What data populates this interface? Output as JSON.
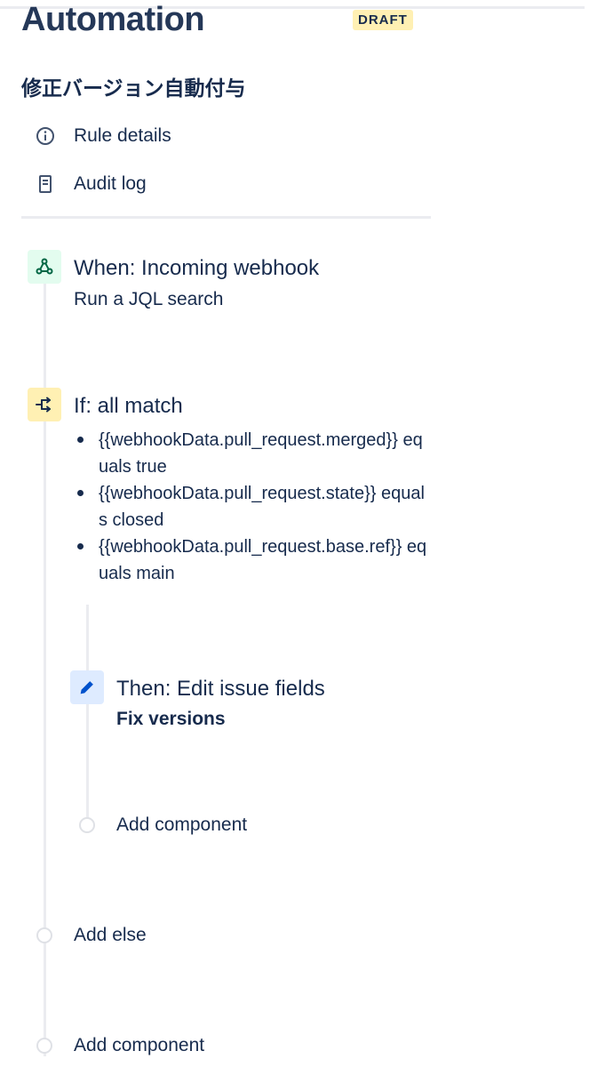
{
  "header": {
    "title": "Automation",
    "status_badge": "DRAFT"
  },
  "rule": {
    "name": "修正バージョン自動付与"
  },
  "nav": {
    "items": [
      {
        "label": "Rule details",
        "icon": "info-icon"
      },
      {
        "label": "Audit log",
        "icon": "document-icon"
      }
    ]
  },
  "components": {
    "trigger": {
      "title": "When: Incoming webhook",
      "subtitle": "Run a JQL search",
      "icon": "webhook-icon",
      "accent": "#e3fcef"
    },
    "condition": {
      "title": "If: all match",
      "icon": "branch-icon",
      "accent": "#fff0b3",
      "items": [
        "{{webhookData.pull_request.merged}} equals true",
        "{{webhookData.pull_request.state}} equals closed",
        "{{webhookData.pull_request.base.ref}} equals main"
      ]
    },
    "action": {
      "title": "Then: Edit issue fields",
      "subtitle": "Fix versions",
      "icon": "pencil-icon",
      "accent": "#deebff"
    },
    "add_inner": {
      "label": "Add component"
    },
    "add_else": {
      "label": "Add else"
    },
    "add_last": {
      "label": "Add component"
    }
  }
}
